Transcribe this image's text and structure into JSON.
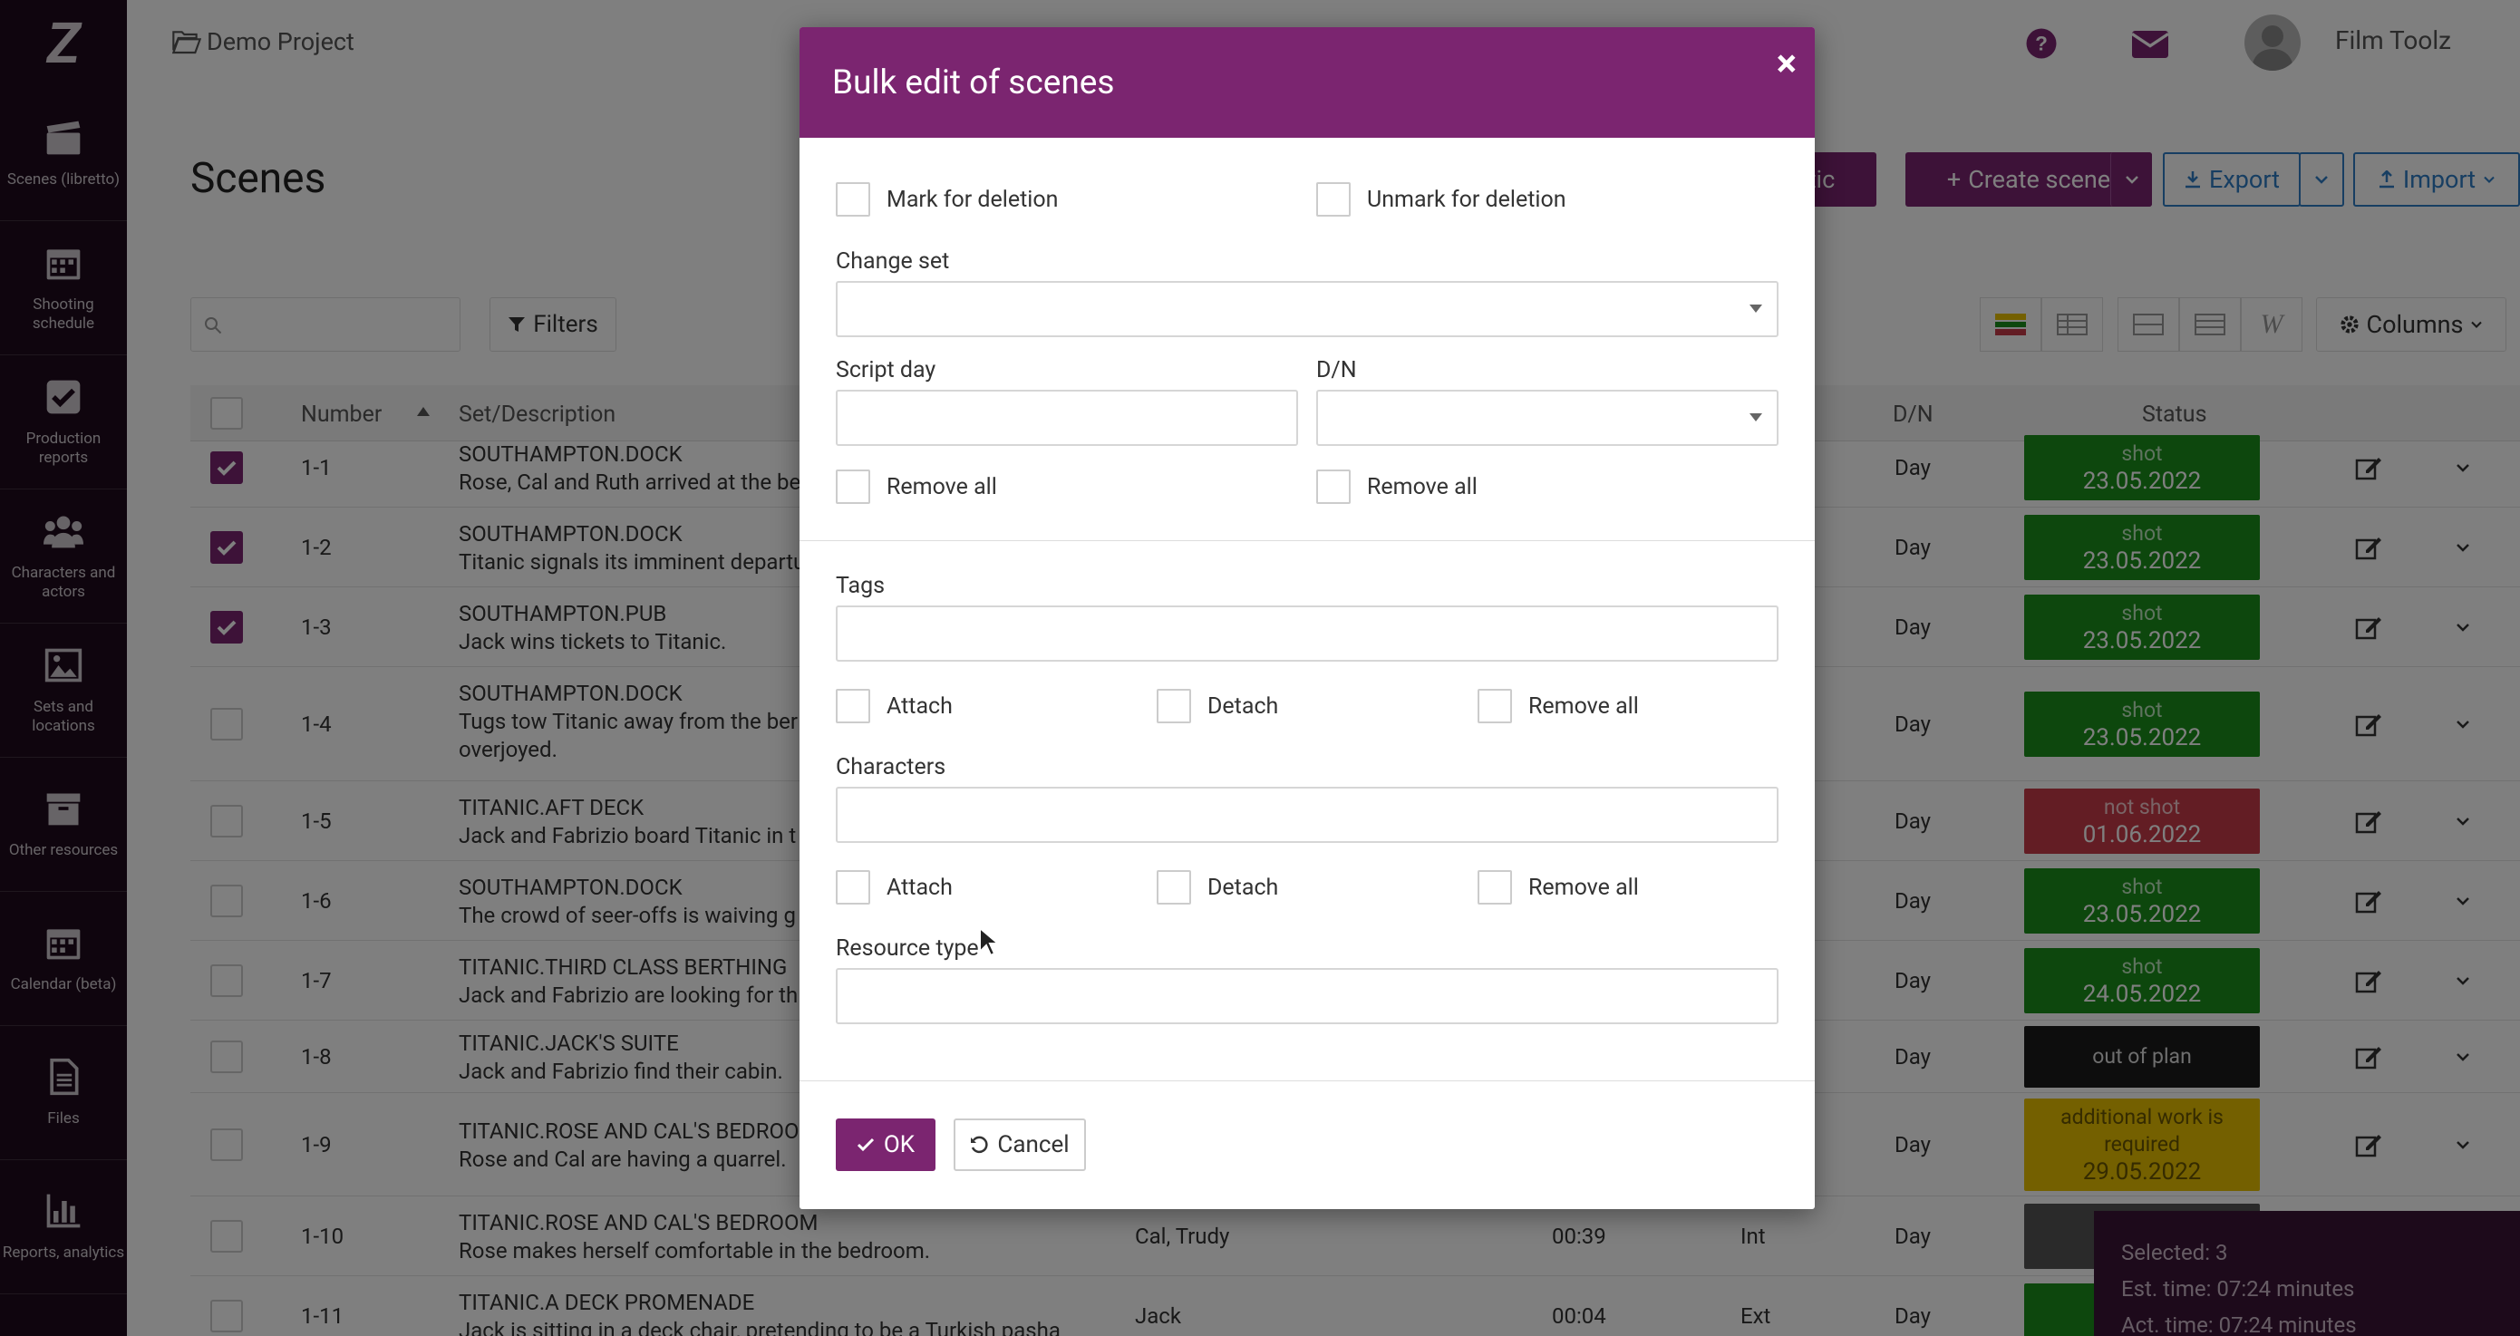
{
  "sidebar": {
    "items": [
      {
        "label": "Scenes (libretto)",
        "icon": "clapperboard-icon"
      },
      {
        "label": "Shooting schedule",
        "icon": "calendar-icon"
      },
      {
        "label": "Production reports",
        "icon": "checkbox-icon"
      },
      {
        "label": "Characters and actors",
        "icon": "users-icon"
      },
      {
        "label": "Sets and locations",
        "icon": "image-icon"
      },
      {
        "label": "Other resources",
        "icon": "archive-icon"
      },
      {
        "label": "Calendar (beta)",
        "icon": "calendar-icon"
      },
      {
        "label": "Files",
        "icon": "file-icon"
      },
      {
        "label": "Reports, analytics",
        "icon": "bar-chart-icon"
      }
    ]
  },
  "header": {
    "project": "Demo Project",
    "user": "Film Toolz"
  },
  "page": {
    "title": "Scenes",
    "analytic_label": "nalytic",
    "create_label": "Create scene",
    "export_label": "Export",
    "import_label": "Import",
    "filters_label": "Filters",
    "columns_label": "Columns"
  },
  "table": {
    "headers": {
      "number": "Number",
      "set": "Set/Description",
      "dn": "D/N",
      "status": "Status"
    },
    "rows": [
      {
        "num": "1-1",
        "set": "SOUTHAMPTON.DOCK",
        "desc": "Rose, Cal and Ruth arrived at the be",
        "desc2": "",
        "chars": "",
        "time": "",
        "ie": "",
        "dn": "Day",
        "status1": "shot",
        "status2": "23.05.2022",
        "status3": "",
        "checked": true
      },
      {
        "num": "1-2",
        "set": "SOUTHAMPTON.DOCK",
        "desc": "Titanic signals its imminent departu",
        "desc2": "",
        "chars": "",
        "time": "",
        "ie": "",
        "dn": "Day",
        "status1": "shot",
        "status2": "23.05.2022",
        "status3": "",
        "checked": true
      },
      {
        "num": "1-3",
        "set": "SOUTHAMPTON.PUB",
        "desc": "Jack wins tickets to Titanic.",
        "desc2": "",
        "chars": "",
        "time": "",
        "ie": "",
        "dn": "Day",
        "status1": "shot",
        "status2": "23.05.2022",
        "status3": "",
        "checked": true
      },
      {
        "num": "1-4",
        "set": "SOUTHAMPTON.DOCK",
        "desc": "Tugs tow Titanic away from the ber",
        "desc2": "overjoyed.",
        "chars": "",
        "time": "",
        "ie": "",
        "dn": "Day",
        "status1": "shot",
        "status2": "23.05.2022",
        "status3": "",
        "checked": false
      },
      {
        "num": "1-5",
        "set": "TITANIC.AFT DECK",
        "desc": "Jack and Fabrizio board Titanic in t",
        "desc2": "",
        "chars": "",
        "time": "",
        "ie": "",
        "dn": "Day",
        "status1": "not shot",
        "status2": "01.06.2022",
        "status3": "",
        "checked": false
      },
      {
        "num": "1-6",
        "set": "SOUTHAMPTON.DOCK",
        "desc": "The crowd of seer-offs is waiving g",
        "desc2": "",
        "chars": "",
        "time": "",
        "ie": "",
        "dn": "Day",
        "status1": "shot",
        "status2": "23.05.2022",
        "status3": "",
        "checked": false
      },
      {
        "num": "1-7",
        "set": "TITANIC.THIRD CLASS BERTHING",
        "desc": "Jack and Fabrizio are looking for th",
        "desc2": "",
        "chars": "",
        "time": "",
        "ie": "",
        "dn": "Day",
        "status1": "shot",
        "status2": "24.05.2022",
        "status3": "",
        "checked": false
      },
      {
        "num": "1-8",
        "set": "TITANIC.JACK'S SUITE",
        "desc": "Jack and Fabrizio find their cabin.",
        "desc2": "",
        "chars": "",
        "time": "",
        "ie": "",
        "dn": "Day",
        "status1": "out of plan",
        "status2": "",
        "status3": "",
        "checked": false
      },
      {
        "num": "1-9",
        "set": "TITANIC.ROSE AND CAL'S BEDROO",
        "desc": "Rose and Cal are having a quarrel.",
        "desc2": "",
        "chars": "",
        "time": "",
        "ie": "",
        "dn": "Day",
        "status1": "additional work is",
        "status2": "required",
        "status3": "29.05.2022",
        "checked": false
      },
      {
        "num": "1-10",
        "set": "TITANIC.ROSE AND CAL'S BEDROOM",
        "desc": "Rose makes herself comfortable in the bedroom.",
        "desc2": "",
        "chars": "Cal, Trudy",
        "time": "00:39",
        "ie": "Int",
        "dn": "Day",
        "status1": "",
        "status2": "",
        "status3": "",
        "checked": false
      },
      {
        "num": "1-11",
        "set": "TITANIC.A DECK PROMENADE",
        "desc": "Jack is sitting in a deck chair, pretending to be a Turkish pasha",
        "desc2": "",
        "chars": "Jack",
        "time": "00:04",
        "ie": "Ext",
        "dn": "Day",
        "status1": "",
        "status2": "",
        "status3": "",
        "checked": false
      }
    ],
    "status_colors": [
      "#1a8f1a",
      "#1a8f1a",
      "#1a8f1a",
      "#1a8f1a",
      "#c73b48",
      "#1a8f1a",
      "#1a8f1a",
      "#1a1a1a",
      "#e8c100",
      "#555555",
      "#1a8f1a"
    ]
  },
  "modal": {
    "title": "Bulk edit of scenes",
    "close": "×",
    "mark_deletion": "Mark for deletion",
    "unmark_deletion": "Unmark for deletion",
    "change_set": "Change set",
    "script_day": "Script day",
    "dn": "D/N",
    "remove_all": "Remove all",
    "tags": "Tags",
    "attach": "Attach",
    "detach": "Detach",
    "characters": "Characters",
    "resource_type": "Resource type",
    "ok": "OK",
    "cancel": "Cancel"
  },
  "selection": {
    "selected": "Selected: 3",
    "est_time": "Est. time: 07:24 minutes",
    "act_time": "Act. time: 07:24 minutes"
  },
  "colors": {
    "brand": "#7b2570",
    "export": "#2f7dc4",
    "sidebar": "#1e0a1c"
  }
}
